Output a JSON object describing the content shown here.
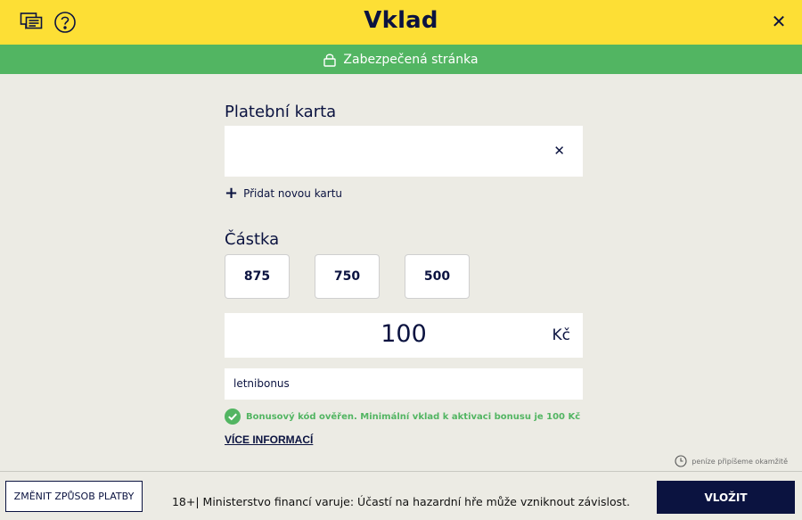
{
  "header": {
    "title": "Vklad",
    "chat_icon": "chat-icon",
    "help_icon": "help-icon",
    "close_symbol": "✕"
  },
  "secure_bar": {
    "text": "Zabezpečená stránka",
    "icon": "lock-icon"
  },
  "card_section": {
    "label": "Platební karta",
    "card_value": "",
    "clear_symbol": "✕",
    "add_card_label": "Přidat novou kartu"
  },
  "amount_section": {
    "label": "Částka",
    "presets": [
      "875",
      "750",
      "500"
    ],
    "amount_value": "100",
    "currency": "Kč"
  },
  "bonus": {
    "code_value": "letnibonus",
    "success_text": "Bonusový kód ověřen. Minimální vklad k aktivaci bonusu je 100 Kč",
    "more_info_label": "VÍCE INFORMACÍ"
  },
  "instant_note": "peníze připíšeme okamžitě",
  "footer": {
    "change_method_label": "ZMĚNIT ZPŮSOB PLATBY",
    "warning": "18+| Ministerstvo financí varuje: Účastí na hazardní hře může vzniknout závislost.",
    "submit_label": "VLOŽIT"
  },
  "colors": {
    "header_bg": "#fddf35",
    "secure_bg": "#52b562",
    "page_bg": "#ecebe4",
    "navy": "#0b1340",
    "success": "#52b562"
  }
}
